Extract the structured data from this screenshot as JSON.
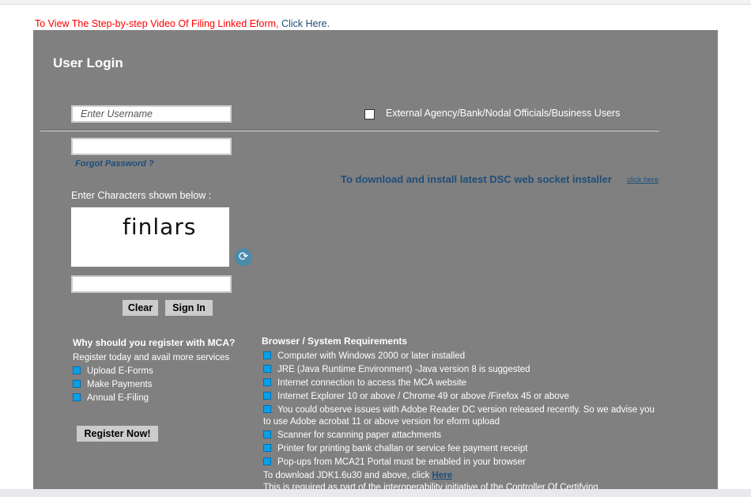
{
  "notice": {
    "text": "To View The Step-by-step Video Of Filing Linked Eform, ",
    "link": "Click Here."
  },
  "login": {
    "title": "User Login",
    "username_placeholder": "Enter Username",
    "external_label": "External Agency/Bank/Nodal Officials/Business Users",
    "forgot": "Forgot Password ?",
    "dsc_text": "To download and install latest DSC web socket installer",
    "dsc_link": "click here",
    "captcha_label": "Enter Characters shown below :",
    "captcha_text": "finlars",
    "clear": "Clear",
    "signin": "Sign In"
  },
  "register": {
    "title": "Why should you register with MCA?",
    "subtitle": "Register today and avail more services",
    "items": [
      "Upload E-Forms",
      "Make Payments",
      "Annual E-Filing"
    ],
    "button": "Register Now!"
  },
  "requirements": {
    "title": "Browser / System Requirements",
    "items": [
      "Computer with Windows 2000 or later installed",
      "JRE (Java Runtime Environment) -Java version 8 is suggested",
      "Internet connection to access the MCA website",
      "Internet Explorer 10 or above / Chrome 49 or above /Firefox 45 or above",
      "You could observe issues with Adobe Reader DC version released recently. So we advise you",
      "to use Adobe acrobat 11 or above version for eform upload",
      "Scanner for scanning paper attachments",
      "Printer for printing bank challan or service fee payment receipt",
      "Pop-ups from MCA21 Portal must be enabled in your browser"
    ],
    "jdk_text": "To download JDK1.6u30 and above, click ",
    "jdk_link": "Here",
    "footer": "This is required as part of the interoperability initiative of the Controller Of Certifying"
  },
  "colors": {
    "panel": "#808080",
    "link": "#1f4e79",
    "notice": "#ff0000",
    "bullet": "#0aa0e8"
  }
}
